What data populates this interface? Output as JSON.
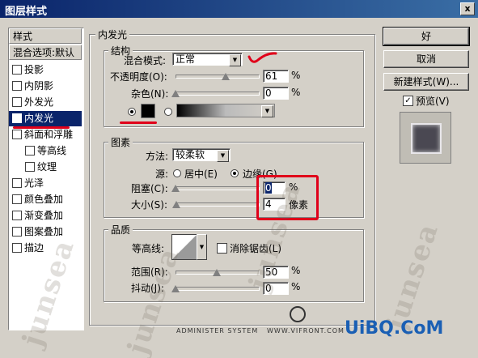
{
  "window": {
    "title": "图层样式",
    "close": "x"
  },
  "sidebar": {
    "header": "样式",
    "blend_options": "混合选项:默认",
    "items": [
      {
        "label": "投影",
        "checked": false
      },
      {
        "label": "内阴影",
        "checked": false
      },
      {
        "label": "外发光",
        "checked": false
      },
      {
        "label": "内发光",
        "checked": true,
        "selected": true
      },
      {
        "label": "斜面和浮雕",
        "checked": false
      },
      {
        "label": "等高线",
        "checked": false,
        "sub": true
      },
      {
        "label": "纹理",
        "checked": false,
        "sub": true
      },
      {
        "label": "光泽",
        "checked": false
      },
      {
        "label": "颜色叠加",
        "checked": false
      },
      {
        "label": "渐变叠加",
        "checked": false
      },
      {
        "label": "图案叠加",
        "checked": false
      },
      {
        "label": "描边",
        "checked": false
      }
    ],
    "check_mark": "✓"
  },
  "panel": {
    "title": "内发光",
    "structure": {
      "title": "结构",
      "blend_mode_label": "混合模式:",
      "blend_mode_value": "正常",
      "opacity_label": "不透明度(O):",
      "opacity_value": "61",
      "opacity_level": 0.61,
      "noise_label": "杂色(N):",
      "noise_value": "0",
      "noise_level": 0,
      "percent": "%"
    },
    "elements": {
      "title": "图素",
      "method_label": "方法:",
      "method_value": "较柔软",
      "source_label": "源:",
      "source_center": "居中(E)",
      "source_edge": "边缘(G)",
      "choke_label": "阻塞(C):",
      "choke_value": "0",
      "size_label": "大小(S):",
      "size_value": "4",
      "percent": "%",
      "px": "像素"
    },
    "quality": {
      "title": "品质",
      "contour_label": "等高线:",
      "antialias_label": "消除锯齿(L)",
      "range_label": "范围(R):",
      "range_value": "50",
      "range_level": 0.5,
      "jitter_label": "抖动(J):",
      "jitter_value": "0",
      "jitter_level": 0,
      "percent": "%"
    }
  },
  "buttons": {
    "ok": "好",
    "cancel": "取消",
    "new_style": "新建样式(W)...",
    "preview": "预览(V)"
  },
  "watermarks": {
    "text": "junsea",
    "bottom_left": "ADMINISTER SYSTEM",
    "bottom_mid": "WWW.VIFRONT.COM",
    "brand": "UiBQ.CoM"
  },
  "colors": {
    "annotation_red": "#e0001a",
    "selection": "#0a246a"
  }
}
